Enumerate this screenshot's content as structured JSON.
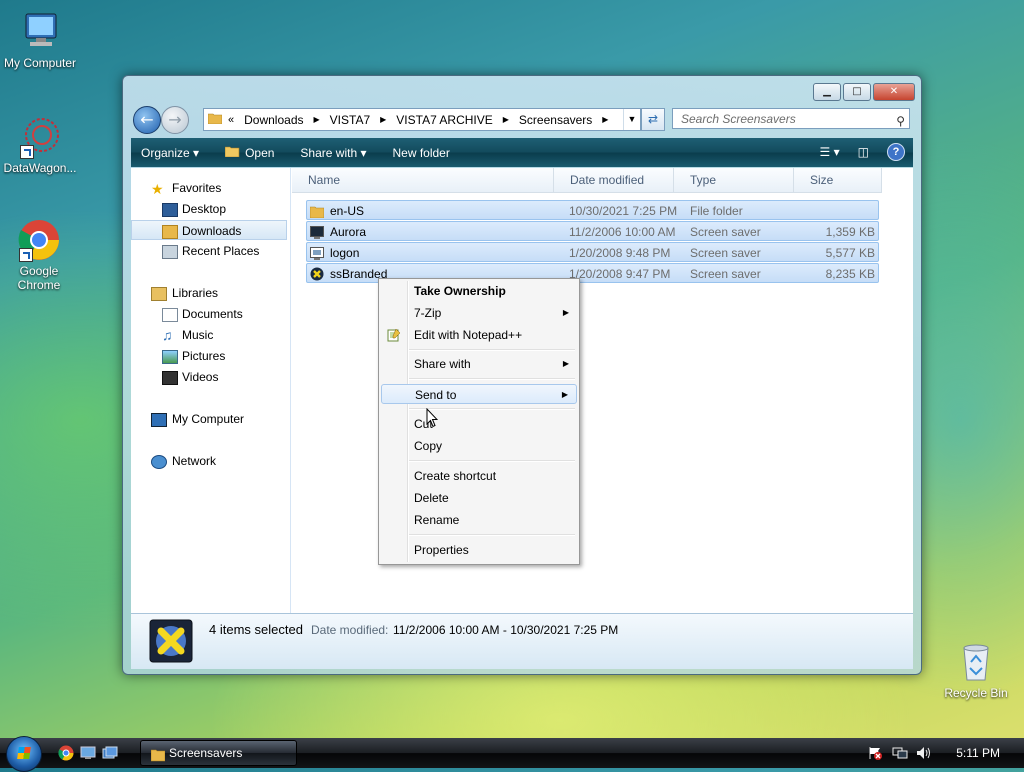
{
  "desktop": {
    "icons": [
      {
        "label": "My Computer"
      },
      {
        "label": "DataWagon..."
      },
      {
        "label": "Google Chrome"
      },
      {
        "label": "Recycle Bin"
      }
    ]
  },
  "window": {
    "caption_buttons": {
      "minimize": "▁",
      "maximize": "□",
      "close": "✕"
    },
    "address": {
      "prefix": "«",
      "crumbs": [
        "Downloads",
        "VISTA7",
        "VISTA7 ARCHIVE",
        "Screensavers"
      ]
    },
    "search": {
      "placeholder": "Search Screensavers"
    },
    "toolbar": {
      "organize": "Organize ▾",
      "open": "Open",
      "share_with": "Share with ▾",
      "new_folder": "New folder",
      "help": "?"
    },
    "nav": {
      "favorites": "Favorites",
      "desktop": "Desktop",
      "downloads": "Downloads",
      "recent_places": "Recent Places",
      "libraries": "Libraries",
      "documents": "Documents",
      "music": "Music",
      "pictures": "Pictures",
      "videos": "Videos",
      "my_computer": "My Computer",
      "network": "Network"
    },
    "columns": {
      "name": "Name",
      "date": "Date modified",
      "type": "Type",
      "size": "Size"
    },
    "files": [
      {
        "name": "en-US",
        "date": "10/30/2021 7:25 PM",
        "type": "File folder",
        "size": "",
        "icon": "folder-icon"
      },
      {
        "name": "Aurora",
        "date": "11/2/2006 10:00 AM",
        "type": "Screen saver",
        "size": "1,359 KB",
        "icon": "screensaver-icon"
      },
      {
        "name": "logon",
        "date": "1/20/2008 9:48 PM",
        "type": "Screen saver",
        "size": "5,577 KB",
        "icon": "screensaver-icon"
      },
      {
        "name": "ssBranded",
        "date": "1/20/2008 9:47 PM",
        "type": "Screen saver",
        "size": "8,235 KB",
        "icon": "branded-icon"
      }
    ],
    "details": {
      "selected": "4 items selected",
      "date_label": "Date modified:",
      "date_value": "11/2/2006 10:00 AM - 10/30/2021 7:25 PM"
    }
  },
  "context_menu": {
    "items": [
      {
        "label": "Take Ownership",
        "bold": true
      },
      {
        "label": "7-Zip",
        "submenu": true
      },
      {
        "label": "Edit with Notepad++"
      },
      {
        "label": "Share with",
        "submenu": true
      },
      {
        "label": "Send to",
        "submenu": true,
        "highlighted": true
      },
      {
        "label": "Cut"
      },
      {
        "label": "Copy"
      },
      {
        "label": "Create shortcut"
      },
      {
        "label": "Delete"
      },
      {
        "label": "Rename"
      },
      {
        "label": "Properties"
      }
    ]
  },
  "taskbar": {
    "task_label": "Screensavers",
    "clock": "5:11 PM"
  },
  "colors": {
    "toolbar_bg": "#124a5c",
    "selection_bg": "#c6ddf7",
    "selection_border": "#99c3ee"
  }
}
